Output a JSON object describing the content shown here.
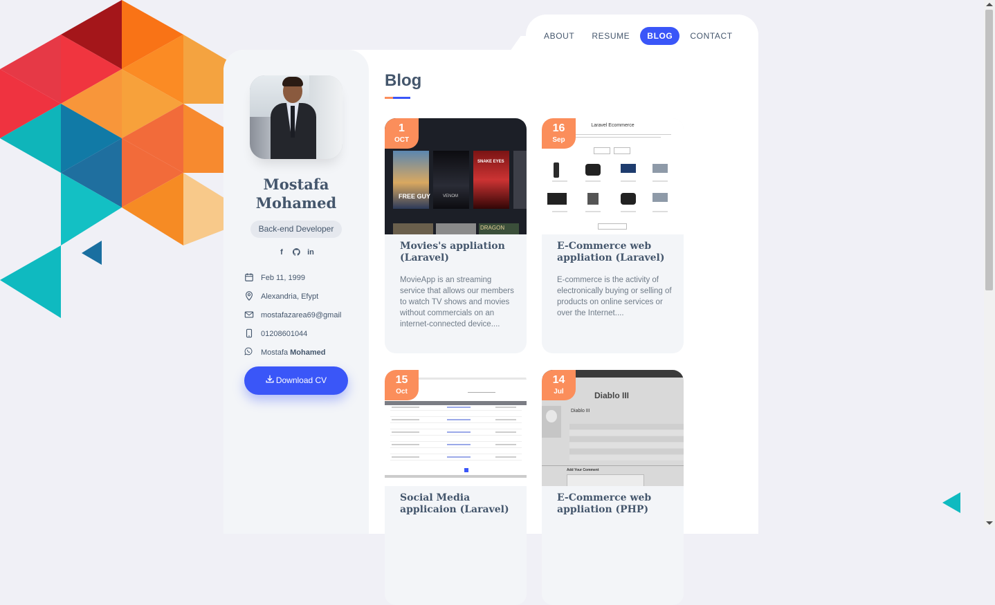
{
  "nav": {
    "items": [
      {
        "label": "ABOUT",
        "active": false
      },
      {
        "label": "RESUME",
        "active": false
      },
      {
        "label": "BLOG",
        "active": true
      },
      {
        "label": "CONTACT",
        "active": false
      }
    ]
  },
  "profile": {
    "name_line1": "Mostafa",
    "name_line2": "Mohamed",
    "role": "Back-end Developer",
    "socials": [
      "f",
      "github",
      "in"
    ],
    "birthday": "Feb 11, 1999",
    "location": "Alexandria, Efypt",
    "email": "mostafazarea69@gmail",
    "phone": "01208601044",
    "whatsapp_first": "Mostafa",
    "whatsapp_last": "Mohamed",
    "download_label": "Download CV"
  },
  "blog": {
    "title": "Blog",
    "posts": [
      {
        "day": "1",
        "month": "OCT",
        "title": "Movies's appliation (Laravel)",
        "excerpt": "MovieApp is an streaming service that allows our members to watch TV shows and movies without commercials on an internet-connected device....",
        "thumb_text": [
          "FREE GUY",
          "VENOM",
          "SNAKE EYES",
          "DRAGON"
        ]
      },
      {
        "day": "16",
        "month": "Sep",
        "title": "E-Commerce web appliation (Laravel)",
        "excerpt": "E-commerce is the activity of electronically buying or selling of products on online services or over the Internet....",
        "thumb_text": [
          "Laravel Ecommerce"
        ]
      },
      {
        "day": "15",
        "month": "Oct",
        "title": "Social Media applicaion (Laravel)",
        "excerpt": ""
      },
      {
        "day": "14",
        "month": "Jul",
        "title": "E-Commerce web appliation (PHP)",
        "excerpt": "",
        "thumb_text": [
          "Diablo III",
          "Diablo III",
          "Add Your Comment"
        ]
      }
    ]
  },
  "colors": {
    "accent": "#3a56f8",
    "date_badge": "#fb8e5b",
    "text": "#44566c",
    "background": "#f0f0f6"
  }
}
